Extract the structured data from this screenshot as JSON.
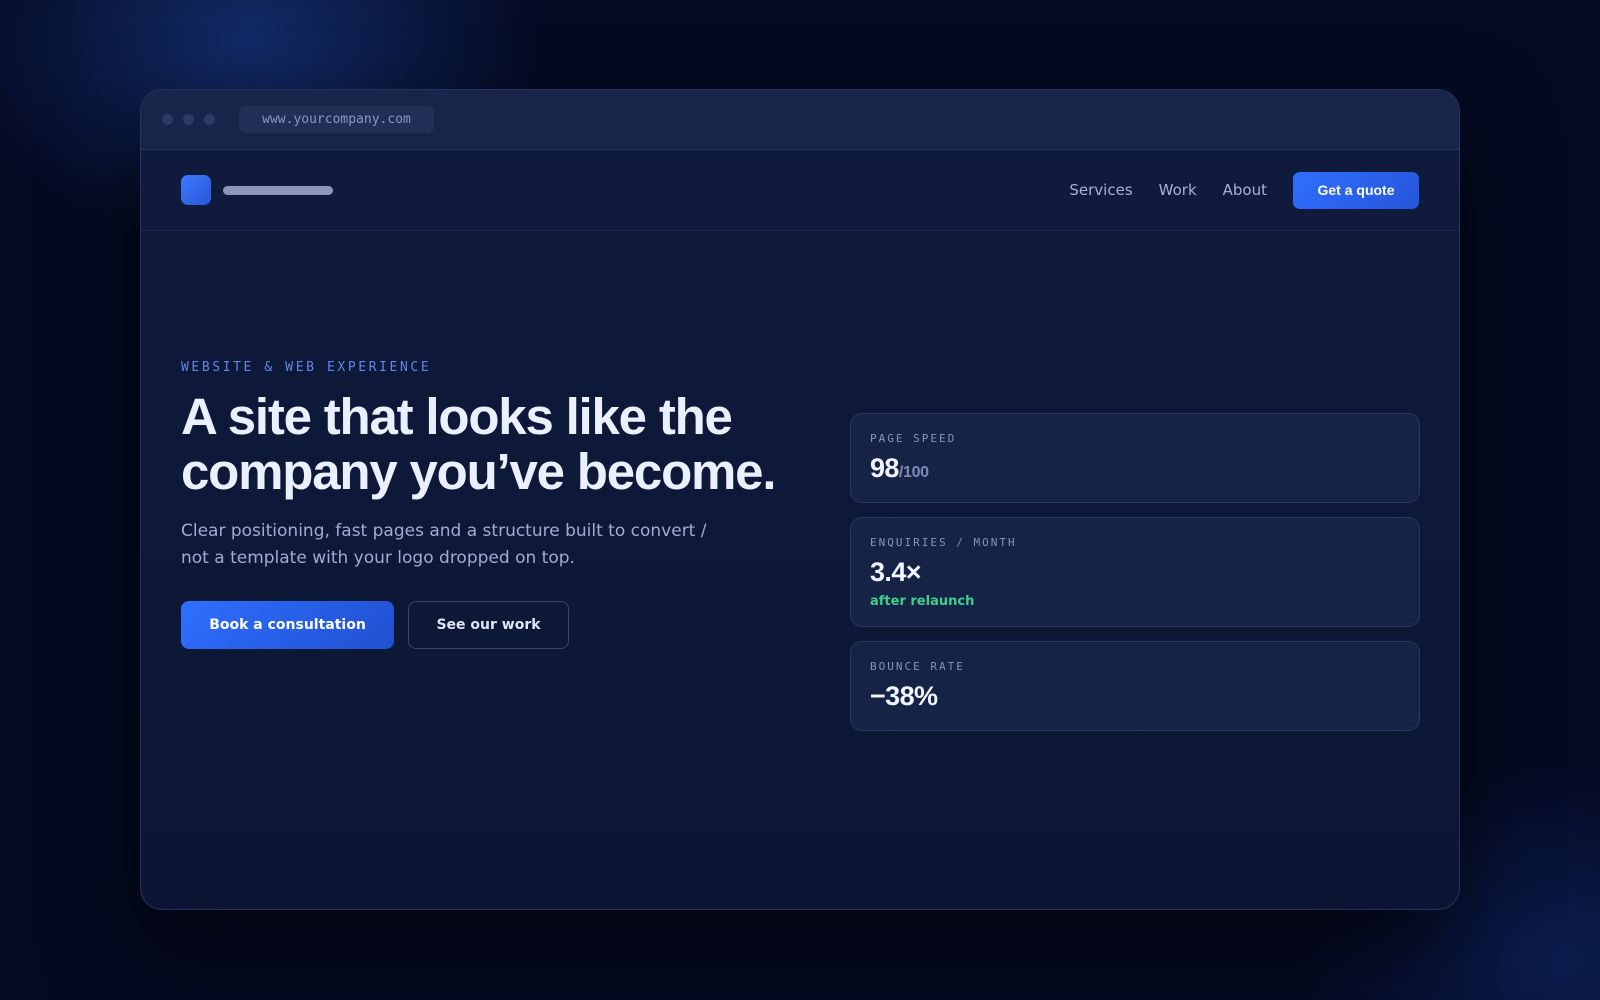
{
  "browser": {
    "url": "www.yourcompany.com"
  },
  "nav": {
    "links": [
      "Services",
      "Work",
      "About"
    ],
    "cta_label": "Get a quote"
  },
  "hero": {
    "eyebrow": "WEBSITE & WEB EXPERIENCE",
    "headline": "A site that looks like the company you’ve become.",
    "subtext": "Clear positioning, fast pages and a structure built to convert / not a template with your logo dropped on top.",
    "primary_cta": "Book a consultation",
    "secondary_cta": "See our work"
  },
  "stats": [
    {
      "label": "PAGE SPEED",
      "value": "98",
      "suffix": "/100"
    },
    {
      "label": "ENQUIRIES / MONTH",
      "value": "3.4×",
      "note": "after relaunch"
    },
    {
      "label": "BOUNCE RATE",
      "value": "−38%"
    }
  ],
  "colors": {
    "accent": "#2f6fff",
    "positive": "#3fd08a",
    "background": "#0f1a3b"
  }
}
